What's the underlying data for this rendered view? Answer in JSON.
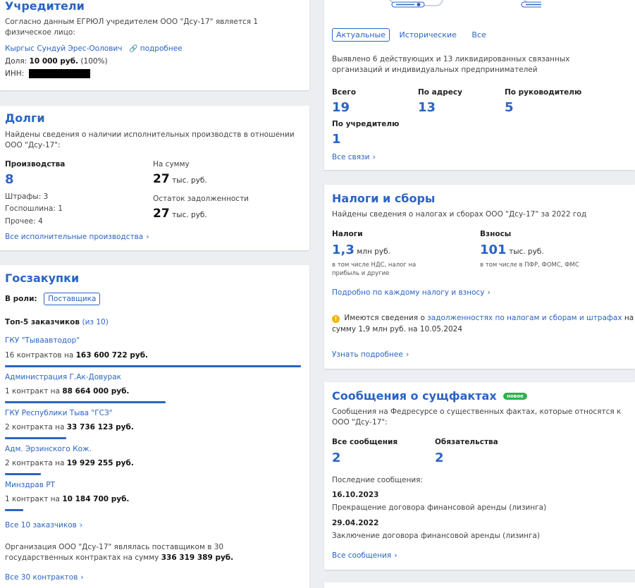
{
  "founders": {
    "title": "Учредители",
    "desc": "Согласно данным ЕГРЮЛ учредителем ООО \"Дсу-17\" является 1 физическое лицо:",
    "person": "Кыргыс Сундуй Эрес-Оолович",
    "more": "подробнее",
    "share_label": "Доля:",
    "share_value": "10 000 руб.",
    "share_pct": "(100%)",
    "inn_label": "ИНН:"
  },
  "debts": {
    "title": "Долги",
    "desc": "Найдены сведения о наличии исполнительных производств в отношении ООО \"Дсу-17\":",
    "proc_label": "Производства",
    "proc_value": "8",
    "sum_label": "На сумму",
    "sum_value": "27",
    "sum_unit": "тыс. руб.",
    "fines": "Штрафы: 3",
    "fee": "Госпошлина: 1",
    "other": "Прочее: 4",
    "rest_label": "Остаток задолженности",
    "rest_value": "27",
    "rest_unit": "тыс. руб.",
    "all_link": "Все исполнительные производства"
  },
  "procurement": {
    "title": "Госзакупки",
    "role_label": "В роли:",
    "role_value": "Поставщика",
    "top_label": "Топ-5 заказчиков",
    "top_of": "(из 10)",
    "customers": [
      {
        "name": "ГКУ \"Тываавтодор\"",
        "count": "16 контрактов на",
        "amount": "163 600 722 руб.",
        "share": 1.0
      },
      {
        "name": "Администрация Г.Ак-Довурак",
        "count": "1 контракт на",
        "amount": "88 664 000 руб.",
        "share": 0.542
      },
      {
        "name": "ГКУ Республики Тыва \"ГСЗ\"",
        "count": "2 контракта на",
        "amount": "33 736 123 руб.",
        "share": 0.206
      },
      {
        "name": "Адм. Эрзинского Кож.",
        "count": "2 контракта на",
        "amount": "19 929 255 руб.",
        "share": 0.122
      },
      {
        "name": "Минздрав РТ",
        "count": "1 контракт на",
        "amount": "10 184 700 руб.",
        "share": 0.062
      }
    ],
    "all_customers": "Все 10 заказчиков",
    "summary_1": "Организация ООО \"Дсу-17\" являлась поставщиком в 30 государственных контрактах на сумму",
    "summary_amount": "336 319 389 руб.",
    "all_contracts": "Все 30 контрактов"
  },
  "links": {
    "tabs": [
      "Актуальные",
      "Исторические",
      "Все"
    ],
    "desc": "Выявлено 6 действующих и 13 ликвидированных связанных организаций и индивидуальных предпринимателей",
    "total_label": "Всего",
    "total_value": "19",
    "addr_label": "По адресу",
    "addr_value": "13",
    "head_label": "По руководителю",
    "head_value": "5",
    "founder_label": "По учредителю",
    "founder_value": "1",
    "all_link": "Все связи"
  },
  "taxes": {
    "title": "Налоги и сборы",
    "desc": "Найдены сведения о налогах и сборах ООО \"Дсу-17\" за 2022 год",
    "tax_label": "Налоги",
    "tax_value": "1,3",
    "tax_unit": "млн руб.",
    "tax_note": "в том числе НДС, налог на прибыль и другие",
    "fee_label": "Взносы",
    "fee_value": "101",
    "fee_unit": "тыс. руб.",
    "fee_note": "в том числе в ПФР, ФОМС, ФМС",
    "detail_link": "Подробно по каждому налогу и взносу",
    "warn_pre": "Имеются сведения о",
    "warn_link": "задолженностях по налогам и сборам и штрафах",
    "warn_post": "на",
    "warn_line2": "сумму 1,9 млн руб. на 10.05.2024",
    "more_link": "Узнать подробнее"
  },
  "facts": {
    "title": "Сообщения о сущфактах",
    "badge": "новое",
    "desc": "Сообщения на Федресурсе о существенных фактах, которые относятся к ООО \"Дсу-17\":",
    "all_label": "Все сообщения",
    "all_value": "2",
    "obl_label": "Обязательства",
    "obl_value": "2",
    "last_label": "Последние сообщения:",
    "items": [
      {
        "date": "16.10.2023",
        "text": "Прекращение договора финансовой аренды (лизинга)"
      },
      {
        "date": "29.04.2022",
        "text": "Заключение договора финансовой аренды (лизинга)"
      }
    ],
    "all_link": "Все сообщения"
  },
  "colors": {
    "accent": "#2a64c5",
    "badge": "#2db24d",
    "warning": "#f0b400"
  }
}
